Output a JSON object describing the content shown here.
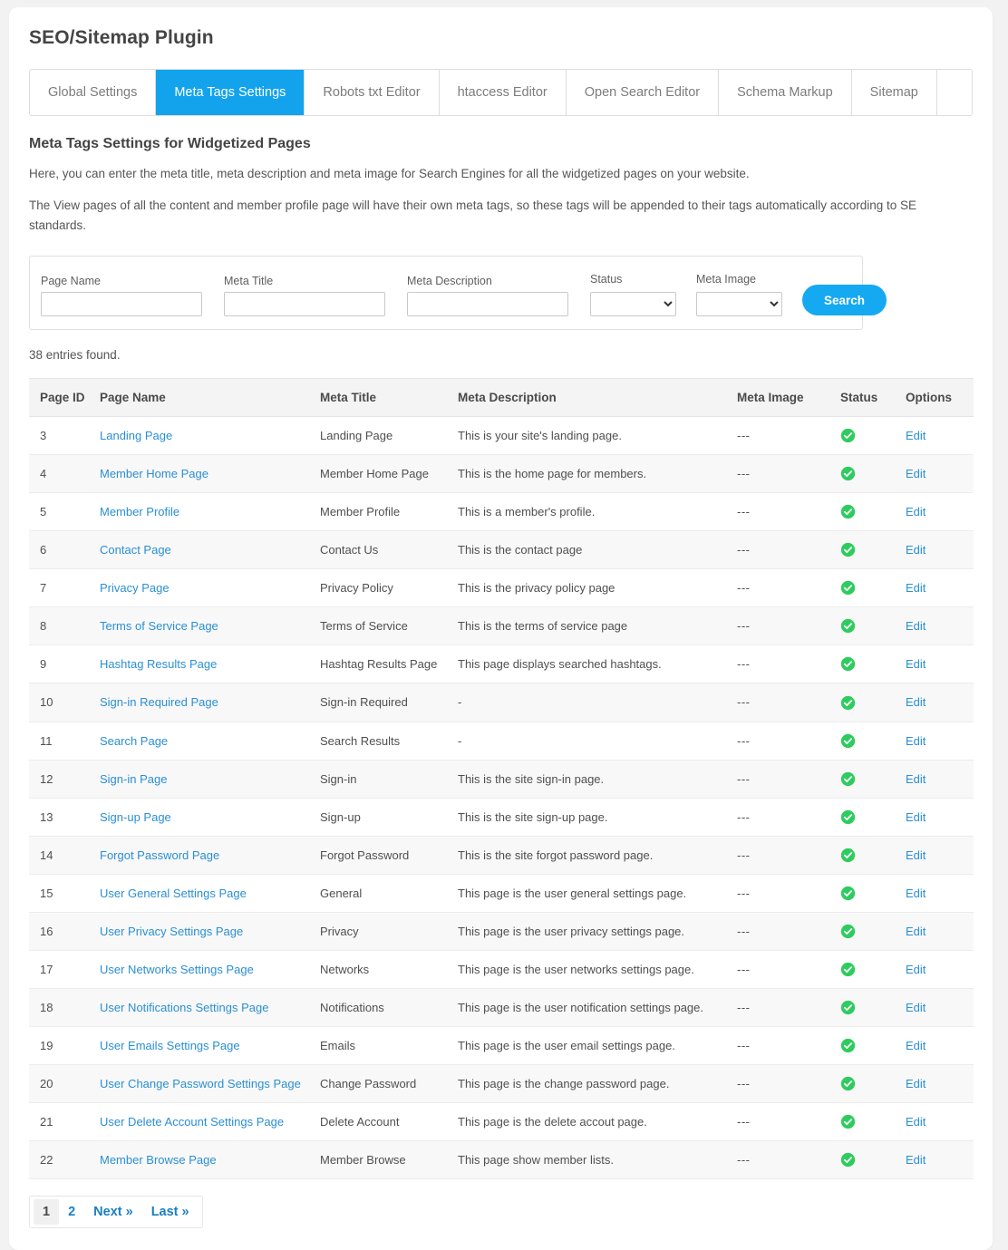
{
  "header": {
    "title": "SEO/Sitemap Plugin"
  },
  "tabs": [
    {
      "label": "Global Settings",
      "active": false
    },
    {
      "label": "Meta Tags Settings",
      "active": true
    },
    {
      "label": "Robots txt Editor",
      "active": false
    },
    {
      "label": "htaccess Editor",
      "active": false
    },
    {
      "label": "Open Search Editor",
      "active": false
    },
    {
      "label": "Schema Markup",
      "active": false
    },
    {
      "label": "Sitemap",
      "active": false
    }
  ],
  "section": {
    "heading": "Meta Tags Settings for Widgetized Pages",
    "paragraph1": "Here, you can enter the meta title, meta description and meta image for Search Engines for all the widgetized pages on your website.",
    "paragraph2": "The View pages of all the content and member profile page will have their own meta tags, so these tags will be appended to their tags automatically according to SE standards."
  },
  "search": {
    "page_name": {
      "label": "Page Name",
      "value": "",
      "placeholder": ""
    },
    "meta_title": {
      "label": "Meta Title",
      "value": "",
      "placeholder": ""
    },
    "meta_description": {
      "label": "Meta Description",
      "value": "",
      "placeholder": ""
    },
    "status": {
      "label": "Status",
      "value": ""
    },
    "meta_image": {
      "label": "Meta Image",
      "value": ""
    },
    "button_label": "Search"
  },
  "results": {
    "entries_found": "38 entries found.",
    "columns": [
      "Page ID",
      "Page Name",
      "Meta Title",
      "Meta Description",
      "Meta Image",
      "Status",
      "Options"
    ],
    "edit_label": "Edit",
    "meta_image_placeholder": "---",
    "rows": [
      {
        "id": "3",
        "name": "Landing Page",
        "title": "Landing Page",
        "desc": "This is your site's landing page.",
        "image": "---",
        "status": "active"
      },
      {
        "id": "4",
        "name": "Member Home Page",
        "title": "Member Home Page",
        "desc": "This is the home page for members.",
        "image": "---",
        "status": "active"
      },
      {
        "id": "5",
        "name": "Member Profile",
        "title": "Member Profile",
        "desc": "This is a member's profile.",
        "image": "---",
        "status": "active"
      },
      {
        "id": "6",
        "name": "Contact Page",
        "title": "Contact Us",
        "desc": "This is the contact page",
        "image": "---",
        "status": "active"
      },
      {
        "id": "7",
        "name": "Privacy Page",
        "title": "Privacy Policy",
        "desc": "This is the privacy policy page",
        "image": "---",
        "status": "active"
      },
      {
        "id": "8",
        "name": "Terms of Service Page",
        "title": "Terms of Service",
        "desc": "This is the terms of service page",
        "image": "---",
        "status": "active"
      },
      {
        "id": "9",
        "name": "Hashtag Results Page",
        "title": "Hashtag Results Page",
        "desc": "This page displays searched hashtags.",
        "image": "---",
        "status": "active"
      },
      {
        "id": "10",
        "name": "Sign-in Required Page",
        "title": "Sign-in Required",
        "desc": "-",
        "image": "---",
        "status": "active"
      },
      {
        "id": "11",
        "name": "Search Page",
        "title": "Search Results",
        "desc": "-",
        "image": "---",
        "status": "active"
      },
      {
        "id": "12",
        "name": "Sign-in Page",
        "title": "Sign-in",
        "desc": "This is the site sign-in page.",
        "image": "---",
        "status": "active"
      },
      {
        "id": "13",
        "name": "Sign-up Page",
        "title": "Sign-up",
        "desc": "This is the site sign-up page.",
        "image": "---",
        "status": "active"
      },
      {
        "id": "14",
        "name": "Forgot Password Page",
        "title": "Forgot Password",
        "desc": "This is the site forgot password page.",
        "image": "---",
        "status": "active"
      },
      {
        "id": "15",
        "name": "User General Settings Page",
        "title": "General",
        "desc": "This page is the user general settings page.",
        "image": "---",
        "status": "active"
      },
      {
        "id": "16",
        "name": "User Privacy Settings Page",
        "title": "Privacy",
        "desc": "This page is the user privacy settings page.",
        "image": "---",
        "status": "active"
      },
      {
        "id": "17",
        "name": "User Networks Settings Page",
        "title": "Networks",
        "desc": "This page is the user networks settings page.",
        "image": "---",
        "status": "active"
      },
      {
        "id": "18",
        "name": "User Notifications Settings Page",
        "title": "Notifications",
        "desc": "This page is the user notification settings page.",
        "image": "---",
        "status": "active"
      },
      {
        "id": "19",
        "name": "User Emails Settings Page",
        "title": "Emails",
        "desc": "This page is the user email settings page.",
        "image": "---",
        "status": "active"
      },
      {
        "id": "20",
        "name": "User Change Password Settings Page",
        "title": "Change Password",
        "desc": "This page is the change password page.",
        "image": "---",
        "status": "active"
      },
      {
        "id": "21",
        "name": "User Delete Account Settings Page",
        "title": "Delete Account",
        "desc": "This page is the delete accout page.",
        "image": "---",
        "status": "active"
      },
      {
        "id": "22",
        "name": "Member Browse Page",
        "title": "Member Browse",
        "desc": "This page show member lists.",
        "image": "---",
        "status": "active"
      }
    ]
  },
  "pagination": [
    {
      "label": "1",
      "current": true
    },
    {
      "label": "2",
      "current": false
    },
    {
      "label": "Next »",
      "current": false
    },
    {
      "label": "Last »",
      "current": false
    }
  ],
  "colors": {
    "accent_blue": "#13a3ec",
    "button_blue": "#15a9f2",
    "link_blue": "#2a8fd4",
    "status_green": "#2ecc5f",
    "page_bg": "#f2f2f2"
  }
}
